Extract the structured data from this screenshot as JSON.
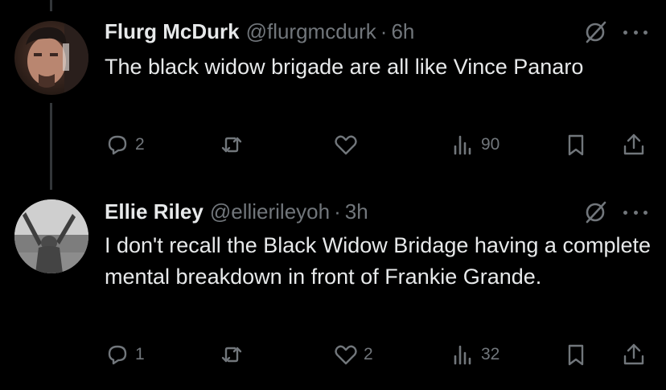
{
  "colors": {
    "background": "#000000",
    "text": "#e7e9ea",
    "muted": "#71767b",
    "thread_line": "#333639"
  },
  "posts": [
    {
      "name": "Flurg McDurk",
      "handle": "@flurgmcdurk",
      "separator": "·",
      "time": "6h",
      "text": "The black widow brigade are all like Vince Panaro",
      "replies": "2",
      "reposts": "",
      "likes": "",
      "views": "90"
    },
    {
      "name": "Ellie Riley",
      "handle": "@ellierileyoh",
      "separator": "·",
      "time": "3h",
      "text": "I don't recall the Black Widow Bridage having a complete mental breakdown in front of Frankie Grande.",
      "replies": "1",
      "reposts": "",
      "likes": "2",
      "views": "32"
    }
  ],
  "icons": [
    "grok-icon",
    "more-icon",
    "reply-icon",
    "repost-icon",
    "like-icon",
    "views-icon",
    "bookmark-icon",
    "share-icon"
  ]
}
